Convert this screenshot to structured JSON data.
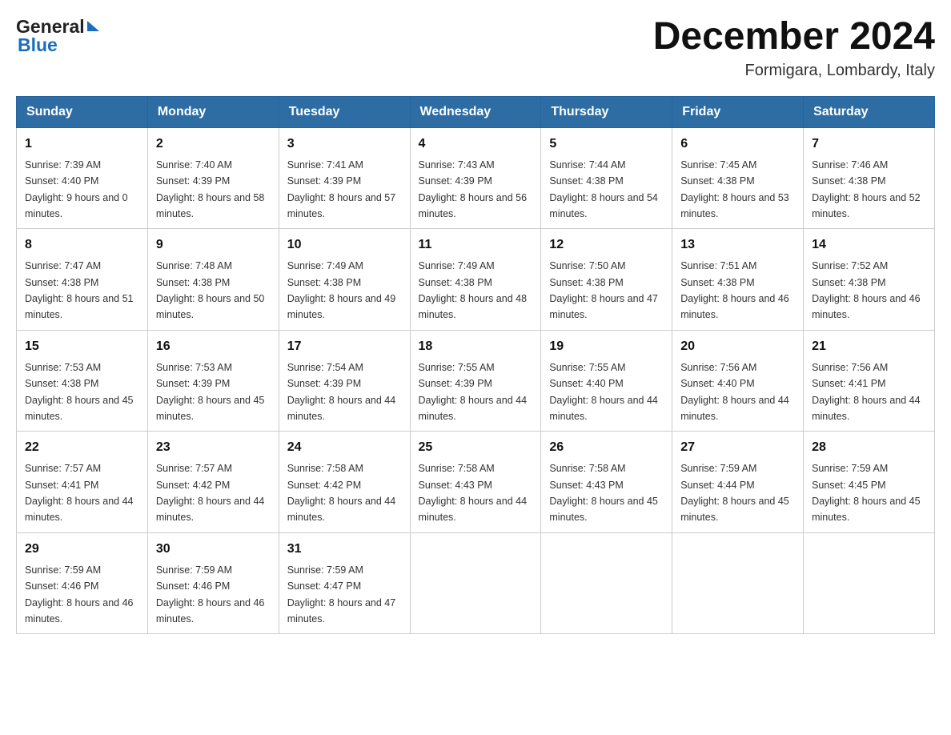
{
  "header": {
    "logo_general": "General",
    "logo_blue": "Blue",
    "month_title": "December 2024",
    "location": "Formigara, Lombardy, Italy"
  },
  "days_of_week": [
    "Sunday",
    "Monday",
    "Tuesday",
    "Wednesday",
    "Thursday",
    "Friday",
    "Saturday"
  ],
  "weeks": [
    [
      {
        "day": "1",
        "sunrise": "7:39 AM",
        "sunset": "4:40 PM",
        "daylight": "9 hours and 0 minutes."
      },
      {
        "day": "2",
        "sunrise": "7:40 AM",
        "sunset": "4:39 PM",
        "daylight": "8 hours and 58 minutes."
      },
      {
        "day": "3",
        "sunrise": "7:41 AM",
        "sunset": "4:39 PM",
        "daylight": "8 hours and 57 minutes."
      },
      {
        "day": "4",
        "sunrise": "7:43 AM",
        "sunset": "4:39 PM",
        "daylight": "8 hours and 56 minutes."
      },
      {
        "day": "5",
        "sunrise": "7:44 AM",
        "sunset": "4:38 PM",
        "daylight": "8 hours and 54 minutes."
      },
      {
        "day": "6",
        "sunrise": "7:45 AM",
        "sunset": "4:38 PM",
        "daylight": "8 hours and 53 minutes."
      },
      {
        "day": "7",
        "sunrise": "7:46 AM",
        "sunset": "4:38 PM",
        "daylight": "8 hours and 52 minutes."
      }
    ],
    [
      {
        "day": "8",
        "sunrise": "7:47 AM",
        "sunset": "4:38 PM",
        "daylight": "8 hours and 51 minutes."
      },
      {
        "day": "9",
        "sunrise": "7:48 AM",
        "sunset": "4:38 PM",
        "daylight": "8 hours and 50 minutes."
      },
      {
        "day": "10",
        "sunrise": "7:49 AM",
        "sunset": "4:38 PM",
        "daylight": "8 hours and 49 minutes."
      },
      {
        "day": "11",
        "sunrise": "7:49 AM",
        "sunset": "4:38 PM",
        "daylight": "8 hours and 48 minutes."
      },
      {
        "day": "12",
        "sunrise": "7:50 AM",
        "sunset": "4:38 PM",
        "daylight": "8 hours and 47 minutes."
      },
      {
        "day": "13",
        "sunrise": "7:51 AM",
        "sunset": "4:38 PM",
        "daylight": "8 hours and 46 minutes."
      },
      {
        "day": "14",
        "sunrise": "7:52 AM",
        "sunset": "4:38 PM",
        "daylight": "8 hours and 46 minutes."
      }
    ],
    [
      {
        "day": "15",
        "sunrise": "7:53 AM",
        "sunset": "4:38 PM",
        "daylight": "8 hours and 45 minutes."
      },
      {
        "day": "16",
        "sunrise": "7:53 AM",
        "sunset": "4:39 PM",
        "daylight": "8 hours and 45 minutes."
      },
      {
        "day": "17",
        "sunrise": "7:54 AM",
        "sunset": "4:39 PM",
        "daylight": "8 hours and 44 minutes."
      },
      {
        "day": "18",
        "sunrise": "7:55 AM",
        "sunset": "4:39 PM",
        "daylight": "8 hours and 44 minutes."
      },
      {
        "day": "19",
        "sunrise": "7:55 AM",
        "sunset": "4:40 PM",
        "daylight": "8 hours and 44 minutes."
      },
      {
        "day": "20",
        "sunrise": "7:56 AM",
        "sunset": "4:40 PM",
        "daylight": "8 hours and 44 minutes."
      },
      {
        "day": "21",
        "sunrise": "7:56 AM",
        "sunset": "4:41 PM",
        "daylight": "8 hours and 44 minutes."
      }
    ],
    [
      {
        "day": "22",
        "sunrise": "7:57 AM",
        "sunset": "4:41 PM",
        "daylight": "8 hours and 44 minutes."
      },
      {
        "day": "23",
        "sunrise": "7:57 AM",
        "sunset": "4:42 PM",
        "daylight": "8 hours and 44 minutes."
      },
      {
        "day": "24",
        "sunrise": "7:58 AM",
        "sunset": "4:42 PM",
        "daylight": "8 hours and 44 minutes."
      },
      {
        "day": "25",
        "sunrise": "7:58 AM",
        "sunset": "4:43 PM",
        "daylight": "8 hours and 44 minutes."
      },
      {
        "day": "26",
        "sunrise": "7:58 AM",
        "sunset": "4:43 PM",
        "daylight": "8 hours and 45 minutes."
      },
      {
        "day": "27",
        "sunrise": "7:59 AM",
        "sunset": "4:44 PM",
        "daylight": "8 hours and 45 minutes."
      },
      {
        "day": "28",
        "sunrise": "7:59 AM",
        "sunset": "4:45 PM",
        "daylight": "8 hours and 45 minutes."
      }
    ],
    [
      {
        "day": "29",
        "sunrise": "7:59 AM",
        "sunset": "4:46 PM",
        "daylight": "8 hours and 46 minutes."
      },
      {
        "day": "30",
        "sunrise": "7:59 AM",
        "sunset": "4:46 PM",
        "daylight": "8 hours and 46 minutes."
      },
      {
        "day": "31",
        "sunrise": "7:59 AM",
        "sunset": "4:47 PM",
        "daylight": "8 hours and 47 minutes."
      },
      null,
      null,
      null,
      null
    ]
  ],
  "labels": {
    "sunrise_prefix": "Sunrise: ",
    "sunset_prefix": "Sunset: ",
    "daylight_prefix": "Daylight: "
  }
}
